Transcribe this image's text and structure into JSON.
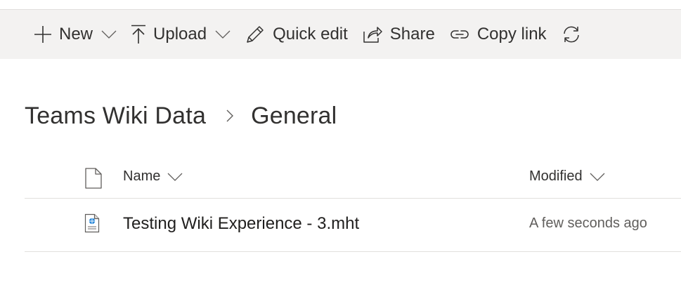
{
  "toolbar": {
    "new_label": "New",
    "upload_label": "Upload",
    "quick_edit_label": "Quick edit",
    "share_label": "Share",
    "copy_link_label": "Copy link",
    "icons": [
      "plus-icon",
      "chevron-down-icon",
      "upload-arrow-icon",
      "pencil-icon",
      "share-icon",
      "link-icon",
      "sync-icon"
    ]
  },
  "breadcrumb": {
    "items": [
      "Teams Wiki Data",
      "General"
    ]
  },
  "list": {
    "columns": {
      "name": "Name",
      "modified": "Modified"
    },
    "rows": [
      {
        "name": "Testing Wiki Experience - 3.mht",
        "modified": "A few seconds ago",
        "icon": "web-archive-file-icon"
      }
    ]
  },
  "colors": {
    "command_bar_bg": "#f3f2f1",
    "text": "#323130",
    "secondary_text": "#605e5c",
    "divider": "#e1dfdd"
  }
}
